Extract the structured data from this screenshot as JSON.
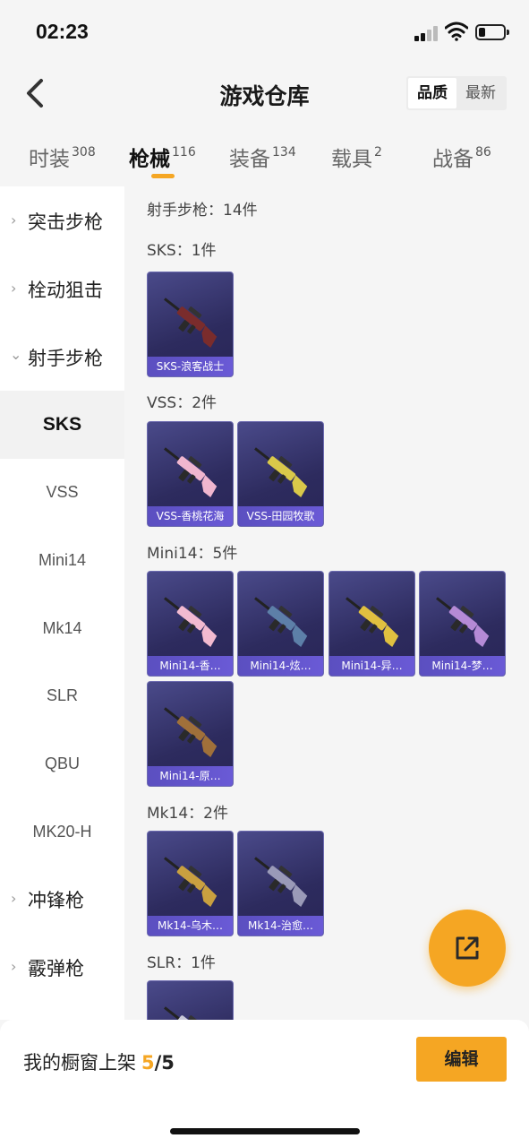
{
  "status_bar": {
    "time": "02:23"
  },
  "header": {
    "title": "游戏仓库",
    "sort_options": [
      "品质",
      "最新"
    ],
    "sort_selected": "品质"
  },
  "tabs": [
    {
      "label": "时装",
      "count": "308",
      "active": false
    },
    {
      "label": "枪械",
      "count": "116",
      "active": true
    },
    {
      "label": "装备",
      "count": "134",
      "active": false
    },
    {
      "label": "载具",
      "count": "2",
      "active": false
    },
    {
      "label": "战备",
      "count": "86",
      "active": false
    }
  ],
  "sidebar": {
    "categories": [
      {
        "label": "突击步枪",
        "expanded": false
      },
      {
        "label": "栓动狙击",
        "expanded": false
      },
      {
        "label": "射手步枪",
        "expanded": true
      },
      {
        "label": "冲锋枪",
        "expanded": false
      },
      {
        "label": "霰弹枪",
        "expanded": false
      }
    ],
    "subitems": [
      "SKS",
      "VSS",
      "Mini14",
      "Mk14",
      "SLR",
      "QBU",
      "MK20-H"
    ],
    "active_subitem": "SKS"
  },
  "content": {
    "summary": "射手步枪：14件",
    "groups": [
      {
        "heading": "SKS：1件",
        "items": [
          "SKS-浪客战士"
        ]
      },
      {
        "heading": "VSS：2件",
        "items": [
          "VSS-香桃花海",
          "VSS-田园牧歌"
        ]
      },
      {
        "heading": "Mini14：5件",
        "items": [
          "Mini14-香…",
          "Mini14-炫…",
          "Mini14-异…",
          "Mini14-梦…",
          "Mini14-原…"
        ]
      },
      {
        "heading": "Mk14：2件",
        "items": [
          "Mk14-乌木…",
          "Mk14-治愈…"
        ]
      },
      {
        "heading": "SLR：1件",
        "items": [
          ""
        ]
      }
    ]
  },
  "bottom_bar": {
    "shelf_label": "我的橱窗上架",
    "shelf_current": "5",
    "shelf_total": "/5",
    "edit_button": "编辑"
  },
  "colors": {
    "accent": "#f5a623",
    "card_bg": "#2d2b5e",
    "card_label_bg": "#5b4fc0"
  },
  "gun_tints": {
    "SKS-浪客战士": "#7a2c2c",
    "VSS-香桃花海": "#f0b6cf",
    "VSS-田园牧歌": "#d9c84a",
    "Mini14-香…": "#f2bad0",
    "Mini14-炫…": "#5d7fa8",
    "Mini14-异…": "#e0c040",
    "Mini14-梦…": "#b58ad6",
    "Mini14-原…": "#a0703a",
    "Mk14-乌木…": "#c9a040",
    "Mk14-治愈…": "#9a9ab8"
  }
}
